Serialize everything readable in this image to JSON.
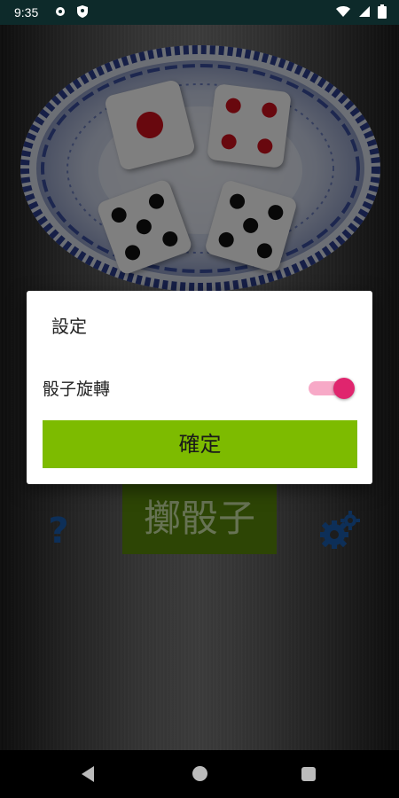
{
  "status_bar": {
    "time": "9:35",
    "icons_left": [
      "settings-gear-icon",
      "shield-icon"
    ],
    "icons_right": [
      "wifi-icon",
      "signal-icon",
      "battery-icon"
    ]
  },
  "game": {
    "dice": [
      {
        "value": 1,
        "pip_color": "#d0101c"
      },
      {
        "value": 4,
        "pip_color": "#d0101c"
      },
      {
        "value": 5,
        "pip_color": "#111111"
      },
      {
        "value": 5,
        "pip_color": "#111111"
      }
    ],
    "help_label": "?",
    "roll_label": "擲骰子",
    "settings_icon": "gear-icon"
  },
  "dialog": {
    "title": "設定",
    "switch_label": "骰子旋轉",
    "switch_on": true,
    "confirm_label": "確定"
  },
  "colors": {
    "accent": "#7dbb00",
    "switch_thumb": "#e0256e",
    "help_blue": "#1b5fb0"
  },
  "nav_bar": {
    "buttons": [
      "back-icon",
      "home-icon",
      "recent-apps-icon"
    ]
  }
}
